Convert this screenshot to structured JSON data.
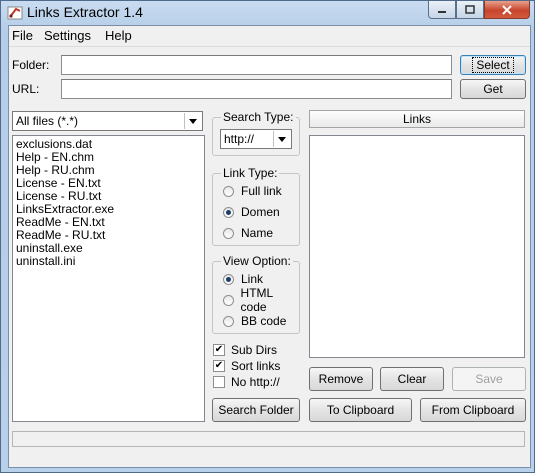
{
  "window": {
    "title": "Links Extractor 1.4"
  },
  "menu": [
    {
      "label": "File"
    },
    {
      "label": "Settings"
    },
    {
      "label": "Help"
    }
  ],
  "folder": {
    "label": "Folder:",
    "value": ""
  },
  "url": {
    "label": "URL:",
    "value": ""
  },
  "buttons": {
    "select": "Select",
    "get": "Get",
    "remove": "Remove",
    "clear": "Clear",
    "save": "Save",
    "search_folder": "Search Folder",
    "to_clipboard": "To Clipboard",
    "from_clipboard": "From Clipboard"
  },
  "file_filter": {
    "selected": "All files (*.*)"
  },
  "files": [
    "exclusions.dat",
    "Help - EN.chm",
    "Help - RU.chm",
    "License - EN.txt",
    "License - RU.txt",
    "LinksExtractor.exe",
    "ReadMe - EN.txt",
    "ReadMe - RU.txt",
    "uninstall.exe",
    "uninstall.ini"
  ],
  "search_type": {
    "title": "Search Type:",
    "selected": "http://"
  },
  "link_type": {
    "title": "Link Type:",
    "options": [
      {
        "label": "Full link",
        "selected": false
      },
      {
        "label": "Domen",
        "selected": true
      },
      {
        "label": "Name",
        "selected": false
      }
    ]
  },
  "view_option": {
    "title": "View Option:",
    "options": [
      {
        "label": "Link",
        "selected": true
      },
      {
        "label": "HTML code",
        "selected": false
      },
      {
        "label": "BB code",
        "selected": false
      }
    ]
  },
  "checkboxes": [
    {
      "label": "Sub Dirs",
      "checked": true
    },
    {
      "label": "Sort links",
      "checked": true
    },
    {
      "label": "No http://",
      "checked": false
    }
  ],
  "links": {
    "header": "Links",
    "items": []
  },
  "status": {
    "text": ""
  }
}
